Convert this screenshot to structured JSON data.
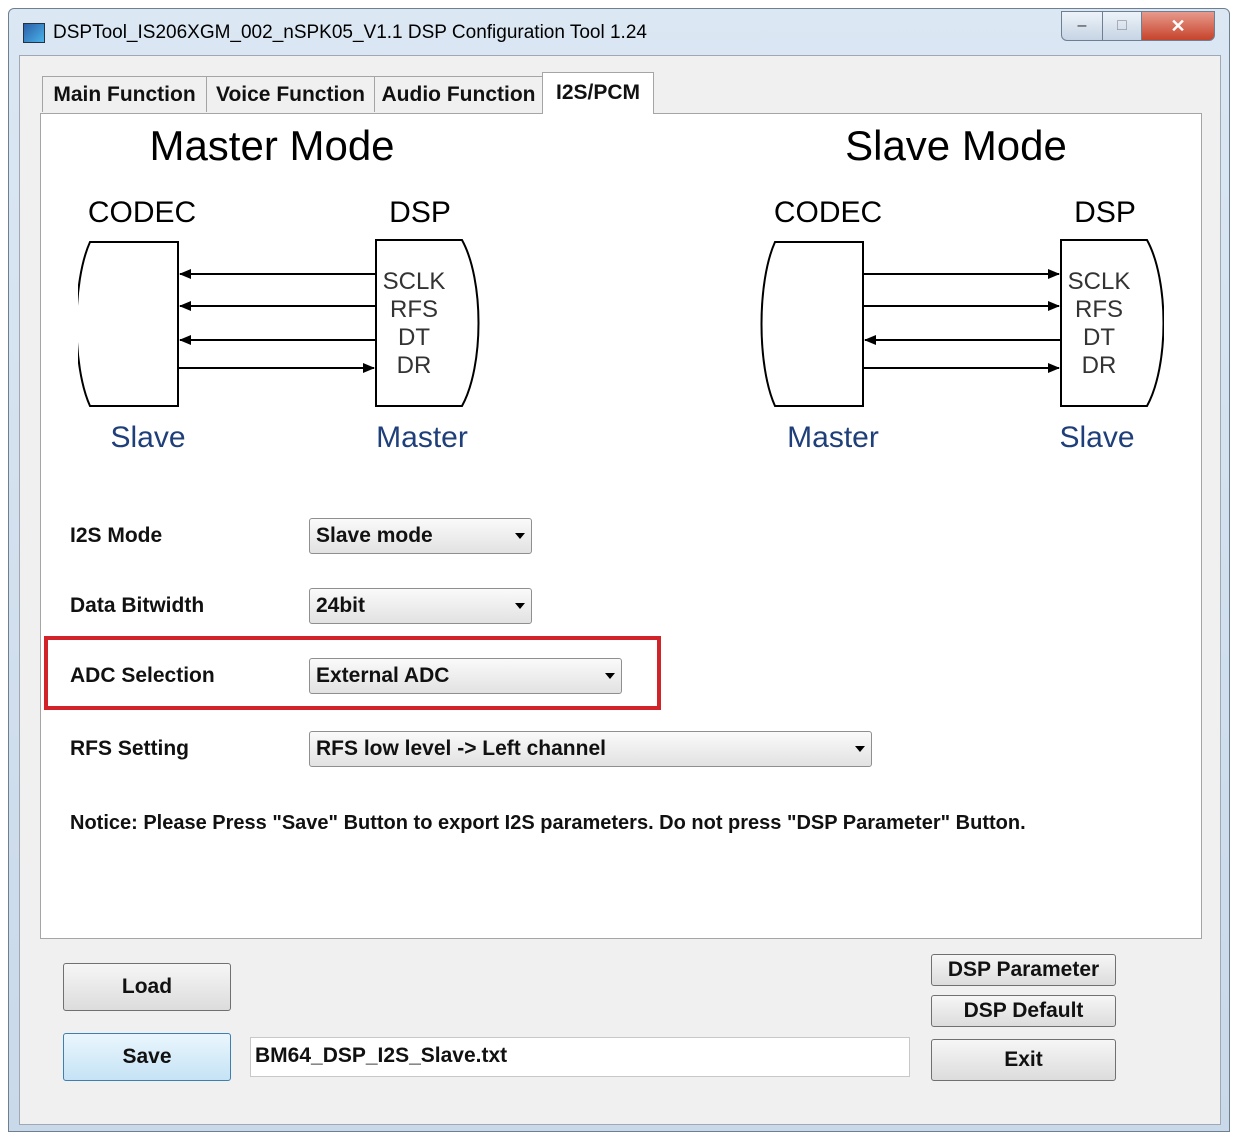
{
  "window": {
    "title": "DSPTool_IS206XGM_002_nSPK05_V1.1 DSP Configuration Tool 1.24",
    "min_glyph": "–",
    "max_glyph": "□",
    "close_glyph": "✕"
  },
  "tabs": [
    {
      "label": "Main Function"
    },
    {
      "label": "Voice Function"
    },
    {
      "label": "Audio Function"
    },
    {
      "label": "I2S/PCM"
    }
  ],
  "diagram": {
    "master": {
      "heading": "Master Mode",
      "left_label": "CODEC",
      "right_label": "DSP",
      "left_role": "Slave",
      "right_role": "Master"
    },
    "slave": {
      "heading": "Slave Mode",
      "left_label": "CODEC",
      "right_label": "DSP",
      "left_role": "Master",
      "right_role": "Slave"
    },
    "signals": [
      "SCLK",
      "RFS",
      "DT",
      "DR"
    ]
  },
  "settings": {
    "i2s_mode": {
      "label": "I2S Mode",
      "value": "Slave mode"
    },
    "bitwidth": {
      "label": "Data Bitwidth",
      "value": "24bit"
    },
    "adc": {
      "label": "ADC Selection",
      "value": "External ADC"
    },
    "rfs": {
      "label": "RFS Setting",
      "value": "RFS low level -> Left channel"
    }
  },
  "notice": "Notice:  Please Press \"Save\" Button to export I2S parameters. Do not press \"DSP Parameter\" Button.",
  "buttons": {
    "load": "Load",
    "save": "Save",
    "dsp_parameter": "DSP Parameter",
    "dsp_default": "DSP Default",
    "exit": "Exit"
  },
  "filename": "BM64_DSP_I2S_Slave.txt",
  "colors": {
    "highlight": "#d2232a",
    "role_text": "#1f3f7a"
  }
}
